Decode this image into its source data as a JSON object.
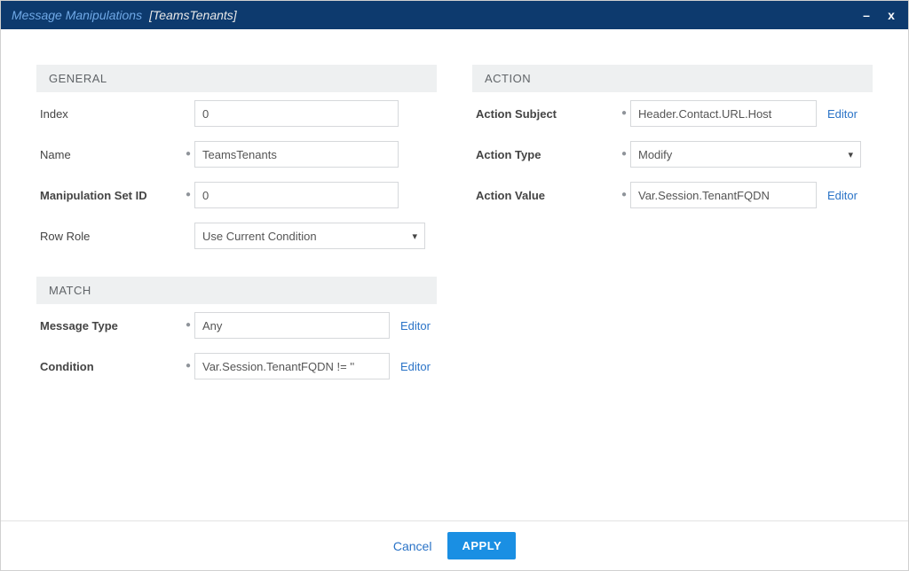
{
  "titlebar": {
    "title": "Message Manipulations",
    "subtitle": "[TeamsTenants]",
    "minimize": "–",
    "close": "x"
  },
  "sections": {
    "general": {
      "heading": "GENERAL"
    },
    "match": {
      "heading": "MATCH"
    },
    "action": {
      "heading": "ACTION"
    }
  },
  "general": {
    "index": {
      "label": "Index",
      "value": "0"
    },
    "name": {
      "label": "Name",
      "value": "TeamsTenants"
    },
    "manip_set_id": {
      "label": "Manipulation Set ID",
      "value": "0"
    },
    "row_role": {
      "label": "Row Role",
      "value": "Use Current Condition"
    }
  },
  "match": {
    "message_type": {
      "label": "Message Type",
      "value": "Any",
      "editor": "Editor"
    },
    "condition": {
      "label": "Condition",
      "value": "Var.Session.TenantFQDN != ''",
      "editor": "Editor"
    }
  },
  "action": {
    "subject": {
      "label": "Action Subject",
      "value": "Header.Contact.URL.Host",
      "editor": "Editor"
    },
    "type": {
      "label": "Action Type",
      "value": "Modify"
    },
    "value": {
      "label": "Action Value",
      "value": "Var.Session.TenantFQDN",
      "editor": "Editor"
    }
  },
  "footer": {
    "cancel": "Cancel",
    "apply": "APPLY"
  }
}
